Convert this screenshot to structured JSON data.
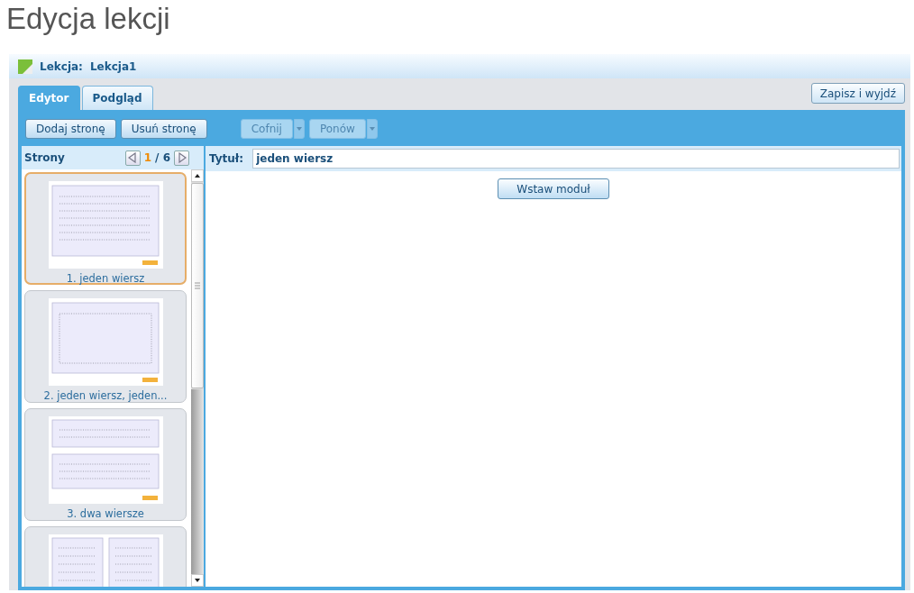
{
  "page_title": "Edycja lekcji",
  "lesson": {
    "label": "Lekcja:",
    "name": "Lekcja1"
  },
  "tabs": [
    {
      "label": "Edytor",
      "selected": true
    },
    {
      "label": "Podgląd",
      "selected": false
    }
  ],
  "save_button": "Zapisz i wyjdź",
  "toolbar": [
    {
      "label": "Dodaj stronę",
      "disabled": false,
      "dropdown": false
    },
    {
      "label": "Usuń stronę",
      "disabled": false,
      "dropdown": false
    },
    {
      "label": "Cofnij",
      "disabled": true,
      "dropdown": true
    },
    {
      "label": "Ponów",
      "disabled": true,
      "dropdown": true
    }
  ],
  "pages_panel": {
    "title": "Strony",
    "current": "1",
    "total": "/ 6"
  },
  "pages": [
    {
      "label": "1. jeden wiersz",
      "kind": "lines",
      "selected": true
    },
    {
      "label": "2. jeden wiersz, jeden...",
      "kind": "box",
      "selected": false
    },
    {
      "label": "3. dwa wiersze",
      "kind": "rows",
      "selected": false
    },
    {
      "kind": "columns",
      "selected": false
    }
  ],
  "title_field": {
    "label": "Tytuł:",
    "value": "jeden wiersz"
  },
  "insert_button": "Wstaw moduł"
}
